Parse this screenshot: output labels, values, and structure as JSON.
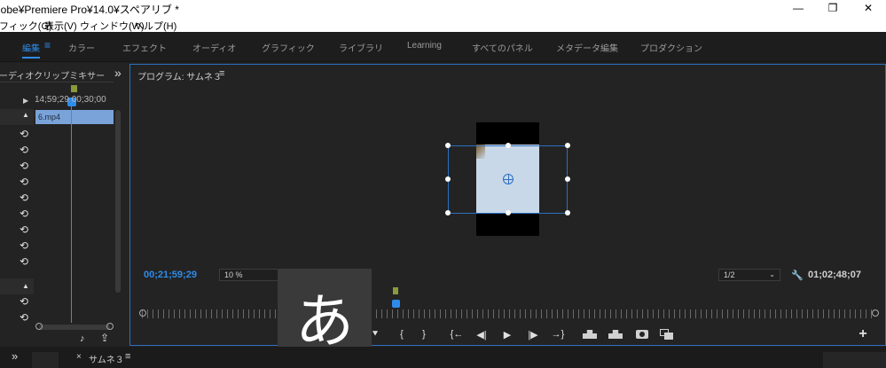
{
  "window": {
    "title": "lobe¥Premiere Pro¥14.0¥スペアリブ *",
    "minimize": "—",
    "restore": "❐",
    "close": "✕"
  },
  "menu": {
    "items": [
      "フィック(G)",
      "表示(V)",
      "ウィンドウ(W)",
      "ヘルプ(H)"
    ]
  },
  "workspaces": {
    "active": "編集",
    "menu_icon": "≡",
    "items": [
      "カラー",
      "エフェクト",
      "オーディオ",
      "グラフィック",
      "ライブラリ",
      "Learning",
      "すべてのパネル",
      "メタデータ編集",
      "プロダクション"
    ]
  },
  "left_panel": {
    "title": "ーディオクリップミキサー",
    "more": "»",
    "timecode": "14;59;29 00;30;00",
    "clip_name": "6.mp4",
    "track_icon": "⟲",
    "up_icon": "▲",
    "play_icon": "▶",
    "music_icon": "♪",
    "export_icon": "⇪"
  },
  "program": {
    "title": "プログラム: サムネ３",
    "menu_icon": "≡",
    "current_timecode": "00;21;59;29",
    "zoom": "10 %",
    "resolution": "1/2",
    "duration": "01;02;48;07",
    "wrench_icon": "🔧",
    "add_icon": "+",
    "controls": [
      "{",
      "}",
      "{←",
      "◀|",
      "▶",
      "|▶",
      "→}"
    ],
    "marker_icon": "⯆"
  },
  "ime": {
    "char": "あ"
  },
  "bottom": {
    "tab_title": "サムネ３",
    "close": "×",
    "menu": "≡",
    "more": "»"
  },
  "colors": {
    "accent": "#2d8ceb",
    "clip": "#7aa3d9",
    "panel_border": "#2d6fc0",
    "timecode_blue": "#2d8ceb"
  }
}
